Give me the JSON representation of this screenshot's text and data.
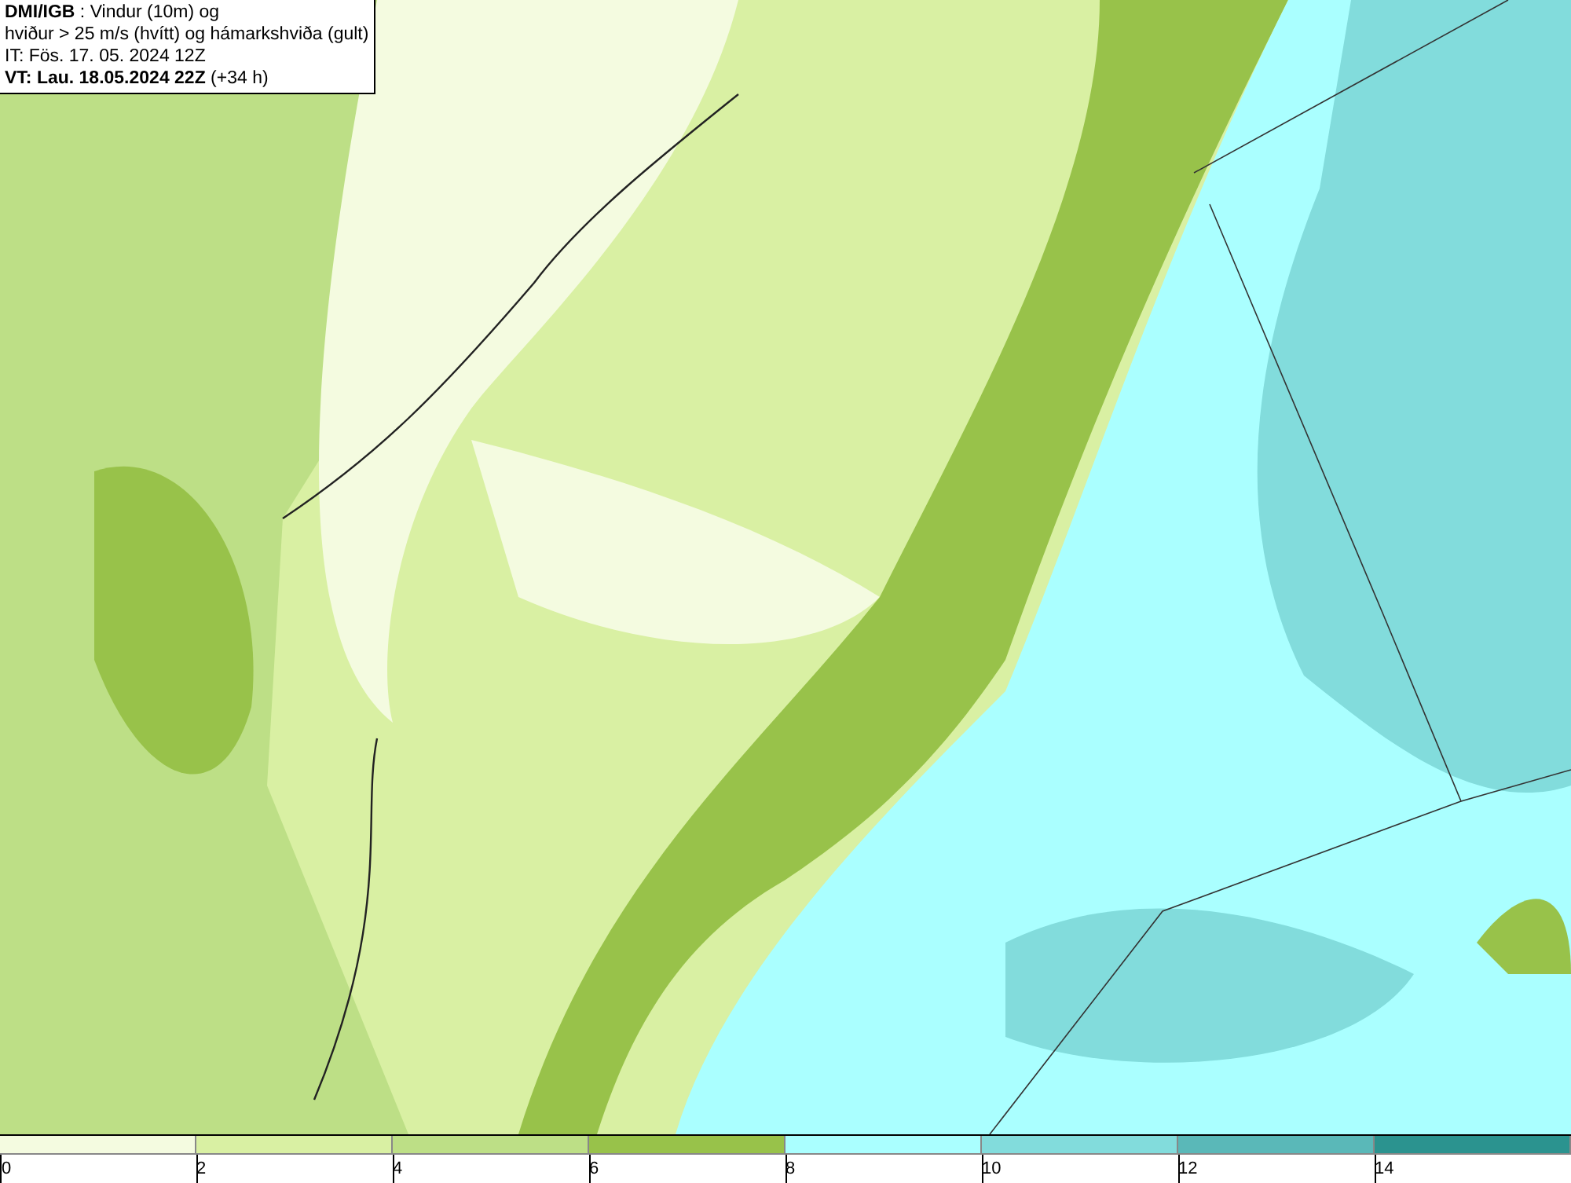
{
  "caption": {
    "lines": [
      "**DMI/IGB** : Vindur (10m) og",
      "hviður > 25 m/s (hvítt) og hámarkshviða (gult)",
      "IT: Fös. 17. 05. 2024 12Z",
      "**VT: Lau. 18.05.2024 22Z** (+34 h)"
    ]
  },
  "legend": {
    "bins": [
      {
        "label": "0",
        "color": "#f4fbe0"
      },
      {
        "label": "2",
        "color": "#d9f0a3"
      },
      {
        "label": "4",
        "color": "#bddf86"
      },
      {
        "label": "6",
        "color": "#98c24a"
      },
      {
        "label": "8",
        "color": "#aaffff"
      },
      {
        "label": "10",
        "color": "#82dcdc"
      },
      {
        "label": "12",
        "color": "#5ab8b8"
      },
      {
        "label": "14",
        "color": "#2b938f"
      }
    ]
  }
}
